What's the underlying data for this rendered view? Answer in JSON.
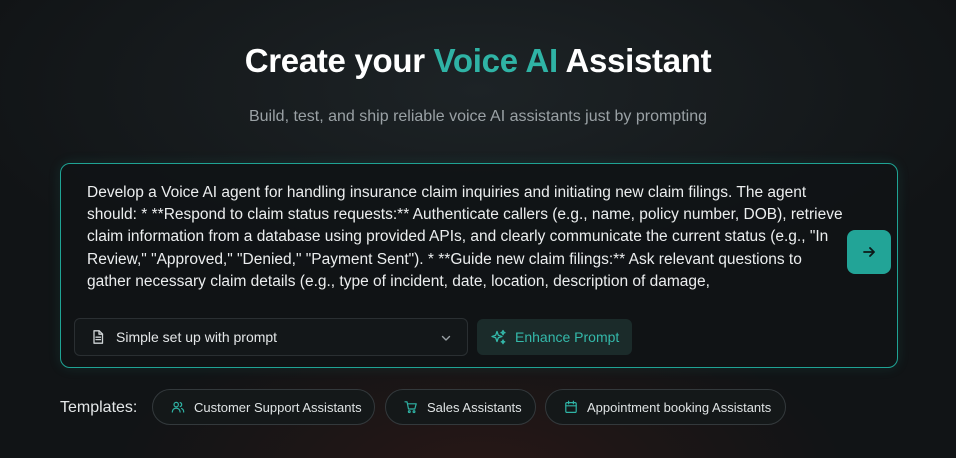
{
  "header": {
    "title_pre": "Create your ",
    "title_accent": "Voice AI",
    "title_post": " Assistant",
    "subtitle": "Build, test, and ship reliable voice AI assistants just by prompting"
  },
  "prompt": {
    "value": "Develop a Voice AI agent for handling insurance claim inquiries and initiating new claim filings. The agent should: * **Respond to claim status requests:** Authenticate callers (e.g., name, policy number, DOB), retrieve claim information from a database using provided APIs, and clearly communicate the current status (e.g., \"In Review,\" \"Approved,\" \"Denied,\" \"Payment Sent\"). * **Guide new claim filings:** Ask relevant questions to gather necessary claim details (e.g., type of incident, date, location, description of damage,",
    "setup_label": "Simple set up with prompt",
    "enhance_label": "Enhance Prompt"
  },
  "templates": {
    "label": "Templates:",
    "items": [
      {
        "label": "Customer Support Assistants",
        "icon": "users-icon"
      },
      {
        "label": "Sales Assistants",
        "icon": "cart-icon"
      },
      {
        "label": "Appointment booking Assistants",
        "icon": "calendar-icon"
      }
    ]
  },
  "colors": {
    "accent": "#2fb3a5",
    "send_button": "#22a497",
    "background": "#111416"
  }
}
